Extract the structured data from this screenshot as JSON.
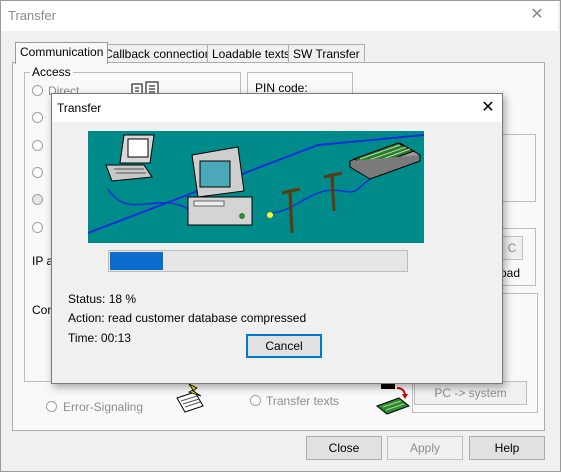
{
  "window": {
    "title": "Transfer",
    "close_symbol": "✕"
  },
  "tabs": [
    {
      "label": "Communication"
    },
    {
      "label": "Callback connection"
    },
    {
      "label": "Loadable texts"
    },
    {
      "label": "SW Transfer"
    }
  ],
  "access": {
    "label": "Access",
    "direct_label": "Direct",
    "ip_label_fragment": "IP a",
    "conn_label_fragment": "Con"
  },
  "pin": {
    "label": "PIN code:"
  },
  "right_fragments": {
    "c_text": "C",
    "load_text": "oad"
  },
  "options": {
    "error_signaling": "Error-Signaling",
    "transfer_texts": "Transfer texts",
    "pc_to_system": "PC -> system"
  },
  "bottom_buttons": {
    "close": "Close",
    "apply": "Apply",
    "help": "Help"
  },
  "dialog": {
    "title": "Transfer",
    "close_symbol": "✕",
    "progress_percent": 18,
    "status": "Status: 18 %",
    "action": "Action: read customer database compressed",
    "time": "Time: 00:13",
    "cancel": "Cancel"
  }
}
